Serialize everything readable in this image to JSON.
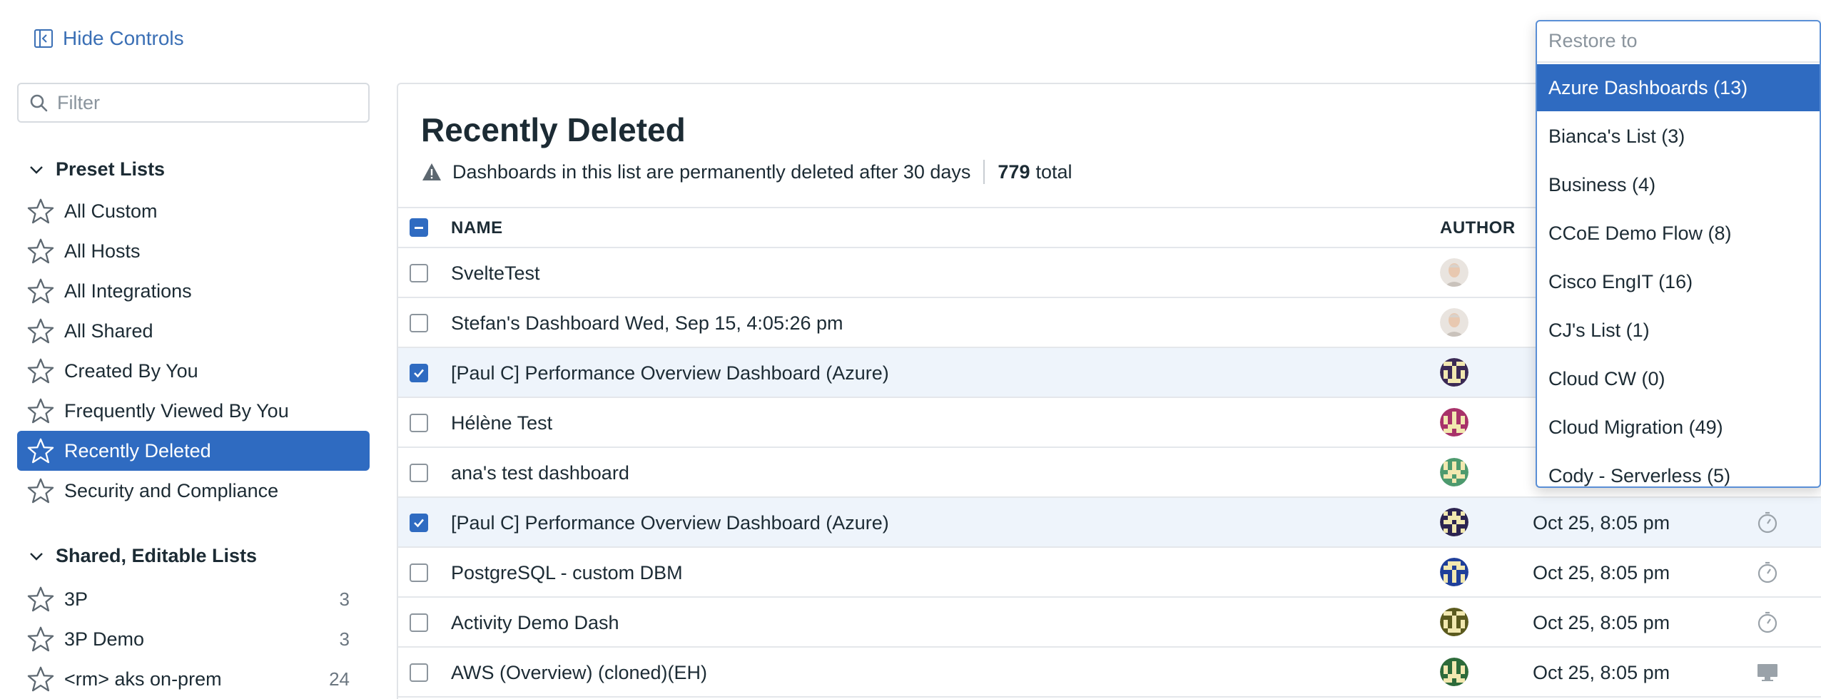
{
  "sidebar": {
    "hide_controls_label": "Hide Controls",
    "filter_placeholder": "Filter",
    "preset_title": "Preset Lists",
    "preset_items": [
      {
        "label": "All Custom"
      },
      {
        "label": "All Hosts"
      },
      {
        "label": "All Integrations"
      },
      {
        "label": "All Shared"
      },
      {
        "label": "Created By You"
      },
      {
        "label": "Frequently Viewed By You"
      },
      {
        "label": "Recently Deleted",
        "active": true
      },
      {
        "label": "Security and Compliance"
      }
    ],
    "shared_title": "Shared, Editable Lists",
    "shared_items": [
      {
        "label": "3P",
        "count": "3"
      },
      {
        "label": "3P Demo",
        "count": "3"
      },
      {
        "label": "<rm> aks on-prem",
        "count": "24"
      }
    ]
  },
  "main": {
    "title": "Recently Deleted",
    "notice": "Dashboards in this list are permanently deleted after 30 days",
    "total_count": "779",
    "total_label": "total",
    "columns": {
      "name": "NAME",
      "author": "AUTHOR"
    },
    "rows": [
      {
        "name": "SvelteTest",
        "checked": false,
        "date": "",
        "icon": "",
        "avatar": "photo"
      },
      {
        "name": "Stefan's Dashboard Wed, Sep 15, 4:05:26 pm",
        "checked": false,
        "date": "",
        "icon": "",
        "avatar": "photo"
      },
      {
        "name": "[Paul C] Performance Overview Dashboard (Azure)",
        "checked": true,
        "date": "",
        "icon": "",
        "avatar": "#3b2a55"
      },
      {
        "name": "Hélène Test",
        "checked": false,
        "date": "",
        "icon": "",
        "avatar": "#a8326a"
      },
      {
        "name": "ana's test dashboard",
        "checked": false,
        "date": "",
        "icon": "",
        "avatar": "#4d9a6e"
      },
      {
        "name": "[Paul C] Performance Overview Dashboard (Azure)",
        "checked": true,
        "date": "Oct 25, 8:05 pm",
        "icon": "timer-icon",
        "avatar": "#2c2450"
      },
      {
        "name": "PostgreSQL - custom DBM",
        "checked": false,
        "date": "Oct 25, 8:05 pm",
        "icon": "timer-icon",
        "avatar": "#1f3f9a"
      },
      {
        "name": "Activity Demo Dash",
        "checked": false,
        "date": "Oct 25, 8:05 pm",
        "icon": "timer-icon",
        "avatar": "#5b5a1e"
      },
      {
        "name": "AWS (Overview) (cloned)(EH)",
        "checked": false,
        "date": "Oct 25, 8:05 pm",
        "icon": "monitor-icon",
        "avatar": "#2d6b3a"
      }
    ]
  },
  "restore_dropdown": {
    "placeholder": "Restore to",
    "options": [
      {
        "label": "Azure Dashboards (13)",
        "highlighted": true
      },
      {
        "label": "Bianca's List (3)"
      },
      {
        "label": "Business (4)"
      },
      {
        "label": "CCoE Demo Flow (8)"
      },
      {
        "label": "Cisco EngIT (16)"
      },
      {
        "label": "CJ's List (1)"
      },
      {
        "label": "Cloud CW (0)"
      },
      {
        "label": "Cloud Migration (49)"
      },
      {
        "label": "Cody - Serverless (5)"
      }
    ]
  },
  "colors": {
    "accent": "#2f6bc1",
    "link": "#3a6fb5",
    "selected_row": "#eef4fb"
  }
}
